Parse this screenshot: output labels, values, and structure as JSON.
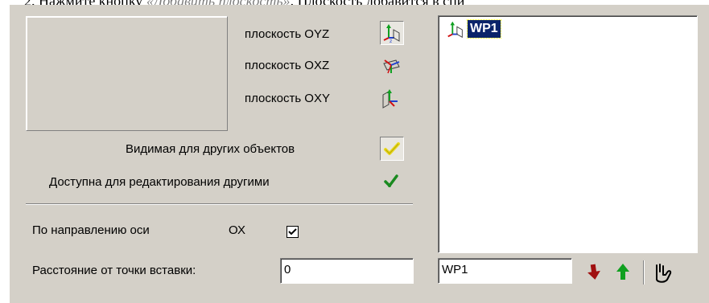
{
  "doc": {
    "prefix": "2.  Нажмите кнопку ",
    "italic": "«Добавить плоскость»",
    "suffix": ". Плоскость добавится в спи"
  },
  "planes": {
    "oyz_label": "плоскость ОYZ",
    "oxz_label": "плоскость ОXZ",
    "oxy_label": "плоскость ОXY"
  },
  "visibility": {
    "visible_label": "Видимая для других объектов",
    "editable_label": "Доступна для редактирования другими"
  },
  "direction": {
    "label": "По направлению оси",
    "axis": "ОХ",
    "checked": true
  },
  "distance": {
    "label": "Расстояние от точки вставки:",
    "value": "0"
  },
  "list": {
    "items": [
      {
        "label": "WP1",
        "icon": "plane-oyz-icon"
      }
    ]
  },
  "name_field": {
    "value": "WP1"
  },
  "colors": {
    "panel_bg": "#d4d0c8",
    "selection_bg": "#0a246a",
    "arrow_red": "#a01010",
    "arrow_green": "#10a020",
    "check_yellow": "#e8d820",
    "check_green": "#1a8a20"
  }
}
